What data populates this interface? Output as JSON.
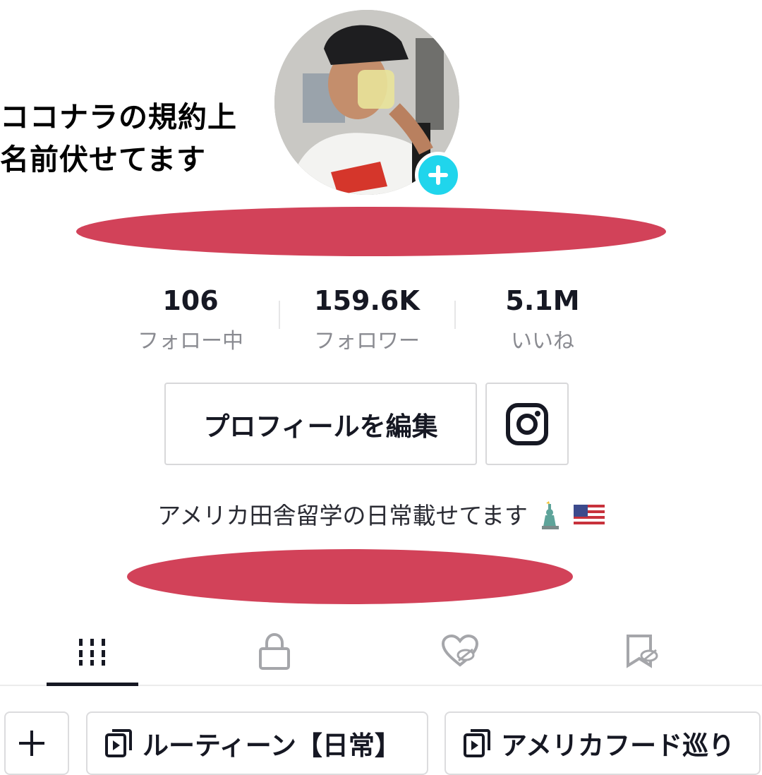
{
  "overlay_caption": [
    "ココナラの規約上",
    "名前伏せてます"
  ],
  "profile": {
    "bio": "アメリカ田舎留学の日常載せてます"
  },
  "stats": [
    {
      "value": "106",
      "label": "フォロー中"
    },
    {
      "value": "159.6K",
      "label": "フォロワー"
    },
    {
      "value": "5.1M",
      "label": "いいね"
    }
  ],
  "buttons": {
    "edit_profile": "プロフィールを編集"
  },
  "tabs": [
    {
      "icon": "grid-icon",
      "active": true
    },
    {
      "icon": "lock-icon",
      "active": false
    },
    {
      "icon": "liked-hidden-icon",
      "active": false
    },
    {
      "icon": "favorites-hidden-icon",
      "active": false
    }
  ],
  "playlists": [
    {
      "label": "ルーティーン【日常】"
    },
    {
      "label": "アメリカフード巡り"
    }
  ],
  "colors": {
    "redaction": "#d24259",
    "add_badge": "#20d5ec",
    "muted_text": "#8a8b91"
  }
}
